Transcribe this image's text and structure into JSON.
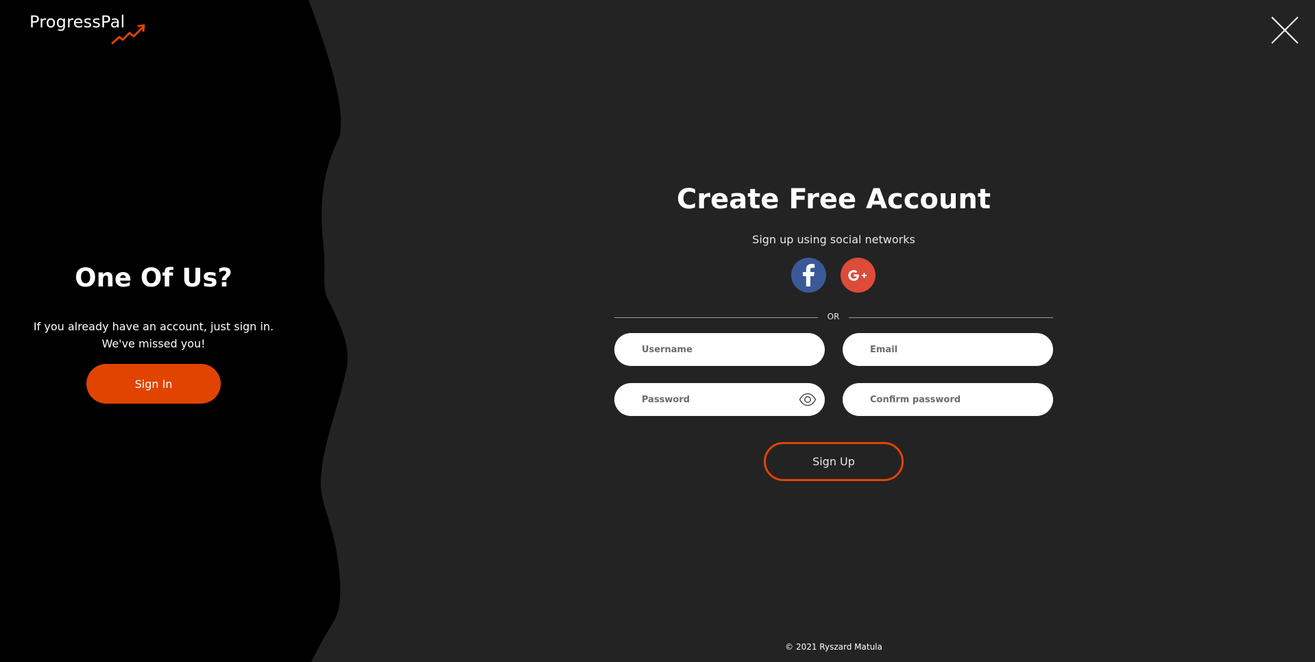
{
  "brand": {
    "name": "ProgressPal",
    "accent_color": "#e04400"
  },
  "close": {
    "icon": "close-icon"
  },
  "left": {
    "title": "One Of Us?",
    "text": "If you already have an account, just sign in. We've missed you!",
    "signin_label": "Sign In"
  },
  "form": {
    "title": "Create Free Account",
    "subtitle": "Sign up using social networks",
    "social": [
      {
        "name": "facebook",
        "icon": "facebook-icon",
        "color": "#3b5998"
      },
      {
        "name": "google-plus",
        "icon": "google-plus-icon",
        "color": "#dd4b39"
      }
    ],
    "divider_text": "OR",
    "fields": {
      "username": {
        "placeholder": "Username",
        "value": ""
      },
      "email": {
        "placeholder": "Email",
        "value": ""
      },
      "password": {
        "placeholder": "Password",
        "value": ""
      },
      "confirm_password": {
        "placeholder": "Confirm password",
        "value": ""
      }
    },
    "password_toggle_icon": "eye-icon",
    "signup_label": "Sign Up"
  },
  "footer": {
    "text": "© 2021 Ryszard Matula"
  }
}
